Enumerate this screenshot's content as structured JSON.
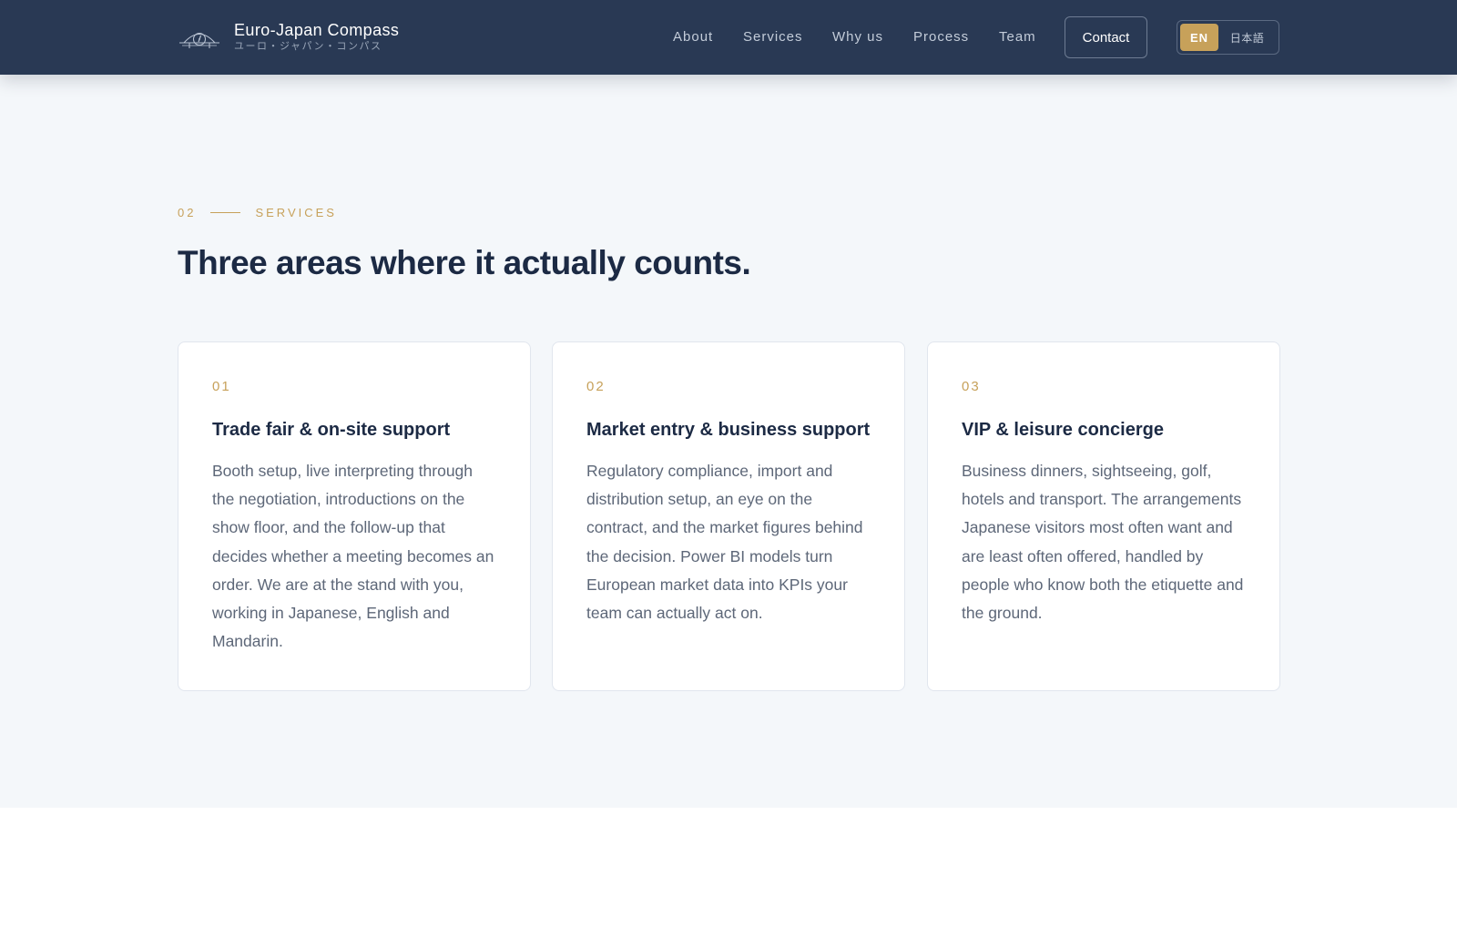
{
  "brand": {
    "name": "Euro-Japan Compass",
    "subtitle": "ユーロ・ジャパン・コンパス"
  },
  "nav": {
    "links": [
      "About",
      "Services",
      "Why us",
      "Process",
      "Team"
    ],
    "contact_label": "Contact",
    "lang": {
      "active": "EN",
      "other": "日本語"
    }
  },
  "services": {
    "eyebrow_number": "02",
    "eyebrow_label": "SERVICES",
    "title": "Three areas where it actually counts.",
    "cards": [
      {
        "number": "01",
        "title": "Trade fair & on-site support",
        "body": "Booth setup, live interpreting through the negotiation, introductions on the show floor, and the follow-up that decides whether a meeting becomes an order. We are at the stand with you, working in Japanese, English and Mandarin."
      },
      {
        "number": "02",
        "title": "Market entry & business support",
        "body": "Regulatory compliance, import and distribution setup, an eye on the contract, and the market figures behind the decision. Power BI models turn European market data into KPIs your team can actually act on."
      },
      {
        "number": "03",
        "title": "VIP & leisure concierge",
        "body": "Business dinners, sightseeing, golf, hotels and transport. The arrangements Japanese visitors most often want and are least often offered, handled by people who know both the etiquette and the ground."
      }
    ]
  },
  "colors": {
    "header_bg": "#293954",
    "accent_gold": "#c7a15a",
    "section_bg": "#f4f7fa",
    "title_navy": "#1c2a44"
  }
}
